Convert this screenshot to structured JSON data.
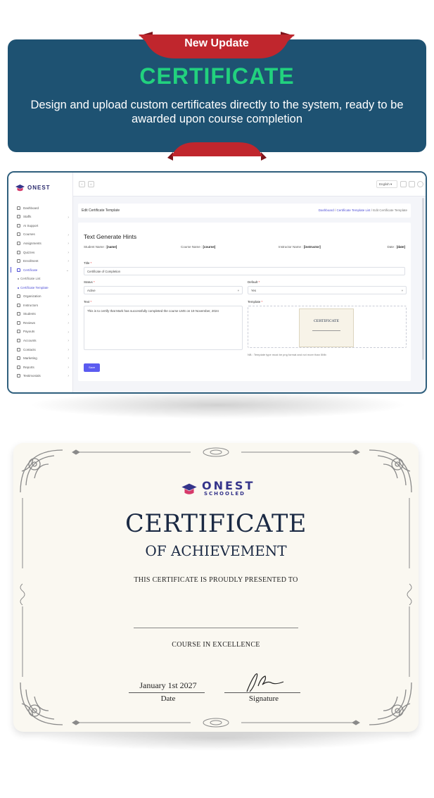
{
  "banner": {
    "ribbon_label": "New Update",
    "title": "CERTIFICATE",
    "description": "Design and upload custom certificates directly to the system, ready to be awarded upon course completion",
    "colors": {
      "panel": "#1e5272",
      "ribbon": "#c0262d",
      "title": "#22d17e"
    }
  },
  "app": {
    "logo": "ONEST",
    "topbar": {
      "back_icon": "chevron-left-icon",
      "home_icon": "home-icon",
      "language": "English"
    },
    "sidebar": [
      {
        "label": "Dashboard",
        "icon": "home-icon",
        "chevron": false
      },
      {
        "label": "Staffs",
        "icon": "users-icon",
        "chevron": true
      },
      {
        "label": "AI Support",
        "icon": "robot-icon",
        "chevron": false
      },
      {
        "label": "Courses",
        "icon": "book-icon",
        "chevron": true
      },
      {
        "label": "Assignments",
        "icon": "clipboard-icon",
        "chevron": true
      },
      {
        "label": "Quizzes",
        "icon": "quiz-icon",
        "chevron": true
      },
      {
        "label": "Enrollment",
        "icon": "enroll-icon",
        "chevron": true
      },
      {
        "label": "Certificate",
        "icon": "certificate-icon",
        "chevron": true,
        "active": true
      },
      {
        "label": "Certificate List",
        "sub": true
      },
      {
        "label": "Certificate Template",
        "sub": true,
        "active": true
      },
      {
        "label": "Organization",
        "icon": "building-icon",
        "chevron": true
      },
      {
        "label": "Instructors",
        "icon": "instructor-icon",
        "chevron": true
      },
      {
        "label": "Students",
        "icon": "student-icon",
        "chevron": true
      },
      {
        "label": "Reviews",
        "icon": "star-icon",
        "chevron": true
      },
      {
        "label": "Payouts",
        "icon": "wallet-icon",
        "chevron": true
      },
      {
        "label": "Accounts",
        "icon": "accounts-icon",
        "chevron": true
      },
      {
        "label": "Contacts",
        "icon": "contacts-icon",
        "chevron": true
      },
      {
        "label": "Marketing",
        "icon": "megaphone-icon",
        "chevron": true
      },
      {
        "label": "Reports",
        "icon": "report-icon",
        "chevron": true
      },
      {
        "label": "Testimonials",
        "icon": "quote-icon",
        "chevron": true
      }
    ],
    "page_title": "Edit Certificate Template",
    "breadcrumb": {
      "crumb1": "Dashboard",
      "crumb2": "Certificate Template List",
      "crumb3": "Edit Certificate Template",
      "sep": "/"
    },
    "form": {
      "section_title": "Text Generate Hints",
      "hints": [
        {
          "label": "Student Name : ",
          "value": "[name]"
        },
        {
          "label": "Course Name : ",
          "value": "[course]"
        },
        {
          "label": "Instructor Name : ",
          "value": "[instructor]"
        },
        {
          "label": "Date : ",
          "value": "[date]"
        }
      ],
      "title_label": "Title",
      "title_value": "Certificate of Completion",
      "status_label": "Status",
      "status_value": "Active",
      "default_label": "Default",
      "default_value": "Yes",
      "text_label": "Text",
      "text_value": "This is to certify that Mark has successfully completed the course LMS on 19 November, 2024",
      "template_label": "Template",
      "note": "NB : Template type must be png format and not more than 5Mb",
      "save_label": "Save",
      "required_mark": "*",
      "thumb_title": "CERTIFICATE"
    }
  },
  "certificate": {
    "logo_name": "ONEST",
    "logo_sub": "SCHOOLED",
    "title": "CERTIFICATE",
    "subtitle": "OF ACHIEVEMENT",
    "presented_to": "THIS CERTIFICATE IS PROUDLY PRESENTED TO",
    "course": "COURSE IN EXCELLENCE",
    "date_value": "January 1st 2027",
    "date_label": "Date",
    "signature_label": "Signature"
  }
}
